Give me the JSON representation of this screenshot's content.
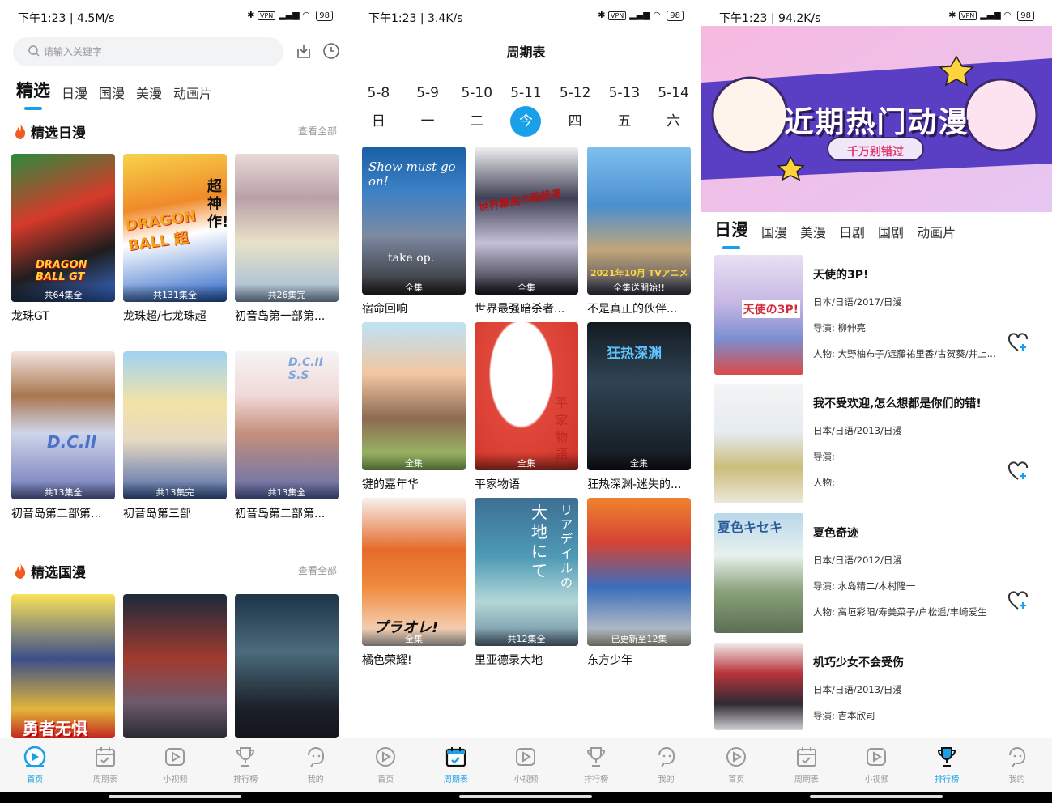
{
  "status_bars": [
    {
      "left": "下午1:23 | 4.5M/s",
      "right_vpn": "VPN",
      "battery": "98"
    },
    {
      "left": "下午1:23 | 3.4K/s",
      "right_vpn": "VPN",
      "battery": "98"
    },
    {
      "left": "下午1:23 | 94.2K/s",
      "right_vpn": "VPN",
      "battery": "98"
    }
  ],
  "home": {
    "search_placeholder": "请输入关键字",
    "tabs": [
      "精选",
      "日漫",
      "国漫",
      "美漫",
      "动画片"
    ],
    "sections": [
      {
        "title": "精选日漫",
        "more": "查看全部"
      },
      {
        "title": "精选国漫",
        "more": "查看全部"
      }
    ],
    "cards": [
      {
        "title": "龙珠GT",
        "badge": "共64集全"
      },
      {
        "title": "龙珠超/七龙珠超",
        "badge": "共131集全"
      },
      {
        "title": "初音岛第一部第...",
        "badge": "共26集完"
      },
      {
        "title": "初音岛第二部第...",
        "badge": "共13集全"
      },
      {
        "title": "初音岛第三部",
        "badge": "共13集完"
      },
      {
        "title": "初音岛第二部第...",
        "badge": "共13集全"
      }
    ],
    "poster_texts": [
      "DRAGON BALL GT",
      "DRAGON BALL 超",
      "超神作!!",
      "D.C.II",
      "D.C.II",
      "D.C.II S.S",
      "勇者无惧"
    ]
  },
  "schedule": {
    "title": "周期表",
    "dates": [
      "5-8",
      "5-9",
      "5-10",
      "5-11",
      "5-12",
      "5-13",
      "5-14"
    ],
    "days": [
      "日",
      "一",
      "二",
      "今",
      "四",
      "五",
      "六"
    ],
    "cards": [
      {
        "title": "宿命回响",
        "badge": "全集"
      },
      {
        "title": "世界最强暗杀者...",
        "badge": "全集"
      },
      {
        "title": "不是真正的伙伴...",
        "badge": "全集送開始!!"
      },
      {
        "title": "键的嘉年华",
        "badge": "全集"
      },
      {
        "title": "平家物语",
        "badge": "全集"
      },
      {
        "title": "狂热深渊-迷失的...",
        "badge": "全集"
      },
      {
        "title": "橘色荣耀!",
        "badge": "全集"
      },
      {
        "title": "里亚德录大地",
        "badge": "共12集全"
      },
      {
        "title": "东方少年",
        "badge": "已更新至12集"
      }
    ],
    "poster_texts": [
      "Show must go on!",
      "take op.",
      "世界最高の暗殺者",
      "2021年10月 TVアニメ",
      "平家物語",
      "狂热深渊",
      "プラオレ!",
      "大地にて",
      "リアデイルの"
    ]
  },
  "ranking": {
    "banner_title": "近期热门动漫",
    "banner_sub": "千万别错过",
    "tabs": [
      "日漫",
      "国漫",
      "美漫",
      "日剧",
      "国剧",
      "动画片"
    ],
    "items": [
      {
        "title": "天使的3P!",
        "meta": "日本/日语/2017/日漫",
        "director": "导演: 柳伸亮",
        "cast": "人物: 大野柚布子/远藤祐里香/古贺葵/井上..."
      },
      {
        "title": "我不受欢迎,怎么想都是你们的错!",
        "meta": "日本/日语/2013/日漫",
        "director": "导演:",
        "cast": "人物:"
      },
      {
        "title": "夏色奇迹",
        "meta": "日本/日语/2012/日漫",
        "director": "导演: 水岛精二/木村隆一",
        "cast": "人物: 高垣彩阳/寿美菜子/户松遥/丰崎爱生"
      },
      {
        "title": "机巧少女不会受伤",
        "meta": "日本/日语/2013/日漫",
        "director": "导演: 吉本欣司",
        "cast": ""
      }
    ],
    "thumb_texts": [
      "天使の3P!",
      "夏色キセキ"
    ]
  },
  "bottom_nav": [
    "首页",
    "周期表",
    "小视频",
    "排行榜",
    "我的"
  ],
  "colors": {
    "accent": "#1aa0e8",
    "fire": "#f25a1f"
  }
}
